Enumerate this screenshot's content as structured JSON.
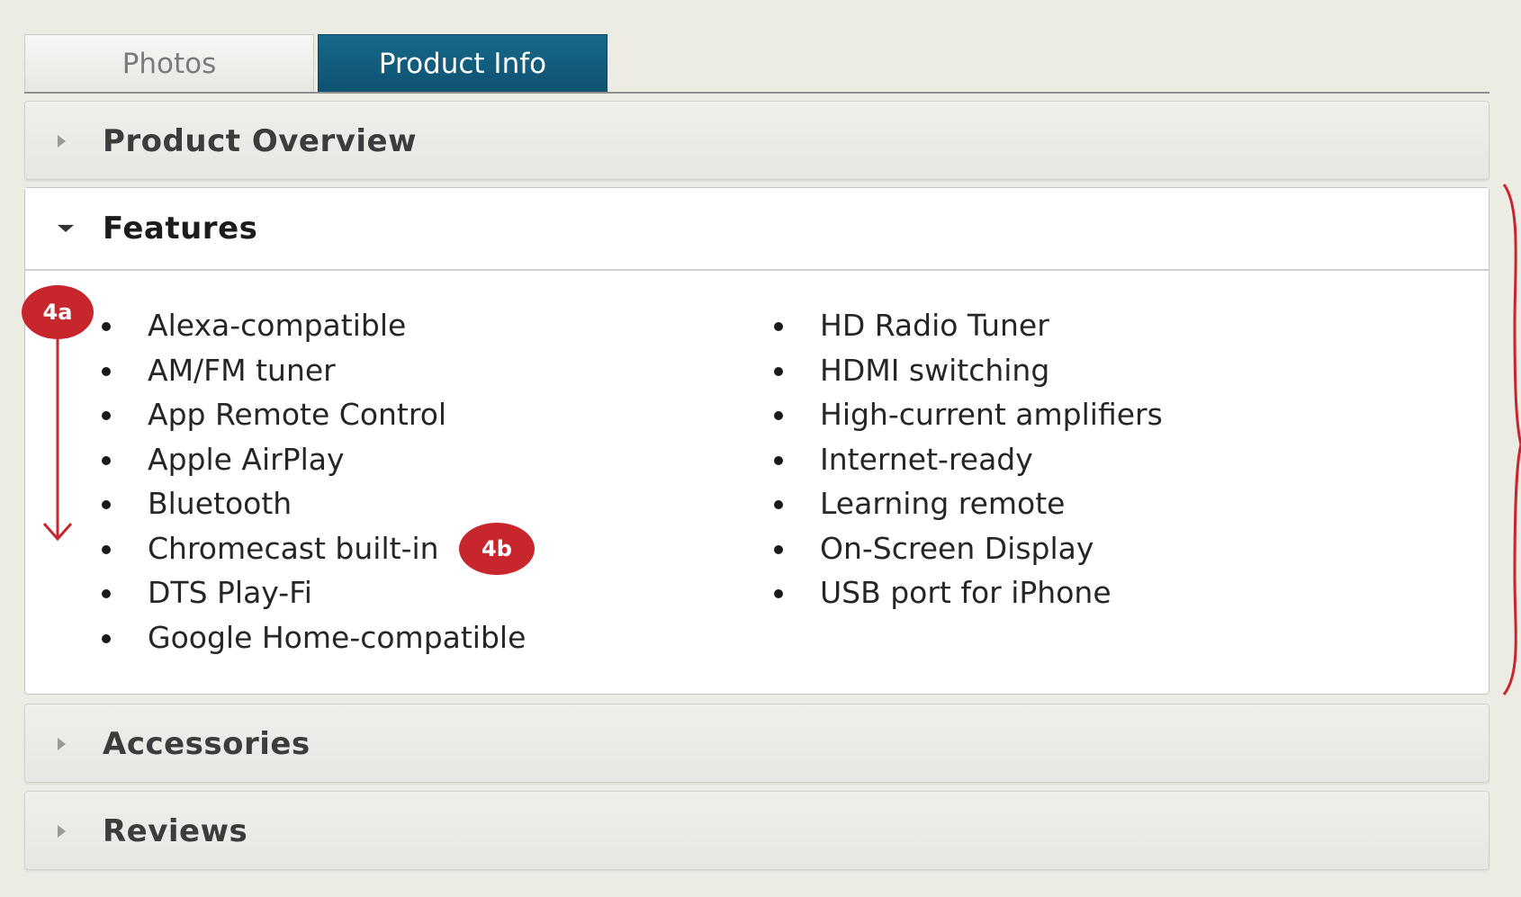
{
  "tabs": {
    "photos": "Photos",
    "product_info": "Product Info",
    "active": "Product Info",
    "active_color": "#126080"
  },
  "panels": {
    "overview": {
      "title": "Product Overview",
      "state": "collapsed"
    },
    "features": {
      "title": "Features",
      "state": "expanded",
      "left_items": [
        "Alexa-compatible",
        "AM/FM tuner",
        "App Remote Control",
        "Apple AirPlay",
        "Bluetooth",
        "Chromecast built-in",
        "DTS Play-Fi",
        "Google Home-compatible"
      ],
      "right_items": [
        "HD Radio Tuner",
        "HDMI switching",
        "High-current amplifiers",
        "Internet-ready",
        "Learning remote",
        "On-Screen Display",
        "USB port for iPhone"
      ]
    },
    "accessories": {
      "title": "Accessories",
      "state": "collapsed"
    },
    "reviews": {
      "title": "Reviews",
      "state": "collapsed"
    }
  },
  "annotations": {
    "badge_4a": "4a",
    "badge_4b": "4b",
    "color": "#c8262d"
  },
  "icons": {
    "collapsed_arrow": "triangle-right-icon",
    "expanded_arrow": "triangle-down-icon"
  }
}
